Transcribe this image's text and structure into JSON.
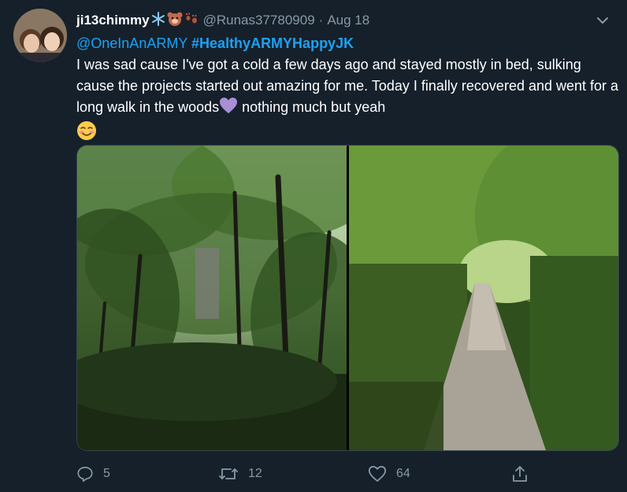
{
  "tweet": {
    "display_name": "ji13chimmy",
    "name_emojis": [
      "snowflake-emoji",
      "bear-emoji",
      "paw-prints-emoji"
    ],
    "handle": "@Runas37780909",
    "separator": "·",
    "date": "Aug 18",
    "mention": "@OneInAnARMY",
    "hashtag": "#HealthyARMYHappyJK",
    "text_part1": "I was sad cause I've got a cold a few days ago and stayed mostly in bed, sulking cause the projects started out amazing for me. Today I finally recovered and went for a long walk in the woods",
    "text_part2": " nothing much but yeah",
    "inline_emojis": [
      "purple-heart-emoji",
      "smiling-face-emoji"
    ],
    "photos": [
      "forest-trees-photo",
      "forest-path-photo"
    ]
  },
  "actions": {
    "reply_count": "5",
    "retweet_count": "12",
    "like_count": "64"
  },
  "colors": {
    "background": "#15202b",
    "text": "#ffffff",
    "secondary": "#8899a6",
    "link": "#1da1f2",
    "border": "#38444d"
  }
}
